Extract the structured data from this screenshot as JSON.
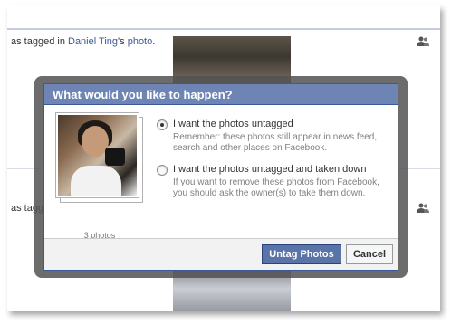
{
  "feed": {
    "row1": {
      "prefix": "as tagged in ",
      "link": "Daniel Ting",
      "suffix": "'s ",
      "link2": "photo",
      "end": "."
    },
    "row2": {
      "prefix": "as tagge"
    }
  },
  "dialog": {
    "title": "What would you like to happen?",
    "photo_count": "3 photos",
    "options": [
      {
        "label": "I want the photos untagged",
        "description": "Remember: these photos still appear in news feed, search and other places on Facebook.",
        "selected": true
      },
      {
        "label": "I want the photos untagged and taken down",
        "description": "If you want to remove these photos from Facebook, you should ask the owner(s) to take them down.",
        "selected": false
      }
    ],
    "primary_button": "Untag Photos",
    "secondary_button": "Cancel"
  },
  "icons": {
    "people": "people-icon",
    "radio_checked": "radio-checked-icon",
    "radio_unchecked": "radio-unchecked-icon"
  },
  "colors": {
    "header_bg": "#6d84b4",
    "link": "#3b5998",
    "primary_button": "#5b74a8"
  }
}
